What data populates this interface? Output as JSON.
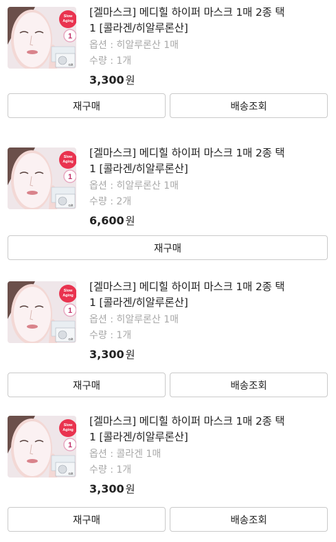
{
  "orders": [
    {
      "title_line1": "[겔마스크] 메디힐 하이퍼 마스크 1매 2종 택",
      "title_line2": "1 [콜라겐/히알루론산]",
      "option": "옵션 : 히알루론산 1매",
      "quantity": "수량 : 1개",
      "price": "3,300",
      "currency": "원",
      "reorder_label": "재구매",
      "tracking_label": "배송조회"
    },
    {
      "title_line1": "[겔마스크] 메디힐 하이퍼 마스크 1매 2종 택",
      "title_line2": "1 [콜라겐/히알루론산]",
      "option": "옵션 : 히알루론산 1매",
      "quantity": "수량 : 2개",
      "price": "6,600",
      "currency": "원",
      "reorder_label": "재구매"
    },
    {
      "title_line1": "[겔마스크] 메디힐 하이퍼 마스크 1매 2종 택",
      "title_line2": "1 [콜라겐/히알루론산]",
      "option": "옵션 : 히알루론산 1매",
      "quantity": "수량 : 1개",
      "price": "3,300",
      "currency": "원",
      "reorder_label": "재구매",
      "tracking_label": "배송조회"
    },
    {
      "title_line1": "[겔마스크] 메디힐 하이퍼 마스크 1매 2종 택",
      "title_line2": "1 [콜라겐/히알루론산]",
      "option": "옵션 : 콜라겐 1매",
      "quantity": "수량 : 1개",
      "price": "3,300",
      "currency": "원",
      "reorder_label": "재구매",
      "tracking_label": "배송조회"
    }
  ],
  "thumbnail": {
    "badge_text_line1": "Slow",
    "badge_text_line2": "Aging",
    "badge_number": "1",
    "pack_label": "Gift",
    "colors": {
      "skin": "#f3d8d5",
      "mask": "#fbf6f7",
      "badge": "#e9334f",
      "lips": "#d9838b"
    }
  }
}
